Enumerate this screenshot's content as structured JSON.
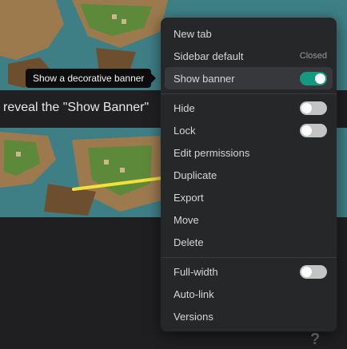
{
  "background": {
    "caption": "reveal the \"Show Banner\""
  },
  "tooltip": {
    "text": "Show a decorative banner"
  },
  "menu": {
    "items": [
      {
        "label": "New tab"
      },
      {
        "label": "Sidebar default",
        "meta": "Closed"
      },
      {
        "label": "Show banner",
        "toggle": true,
        "on": true
      },
      {
        "label": "Hide",
        "toggle": true,
        "on": false
      },
      {
        "label": "Lock",
        "toggle": true,
        "on": false
      },
      {
        "label": "Edit permissions"
      },
      {
        "label": "Duplicate"
      },
      {
        "label": "Export"
      },
      {
        "label": "Move"
      },
      {
        "label": "Delete"
      },
      {
        "label": "Full-width",
        "toggle": true,
        "on": false
      },
      {
        "label": "Auto-link"
      },
      {
        "label": "Versions"
      }
    ]
  },
  "colors": {
    "toggle_on": "#159a80",
    "menu_bg": "#262729",
    "page_bg": "#1f1f21"
  },
  "help_glyph": "?"
}
